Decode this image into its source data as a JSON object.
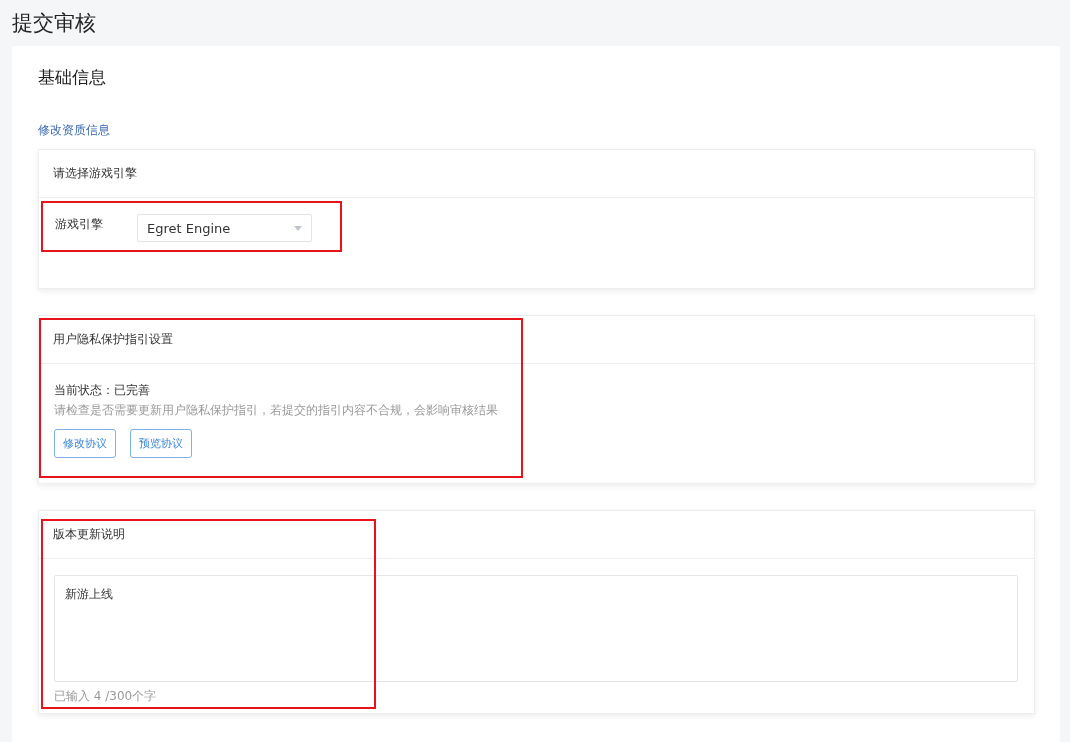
{
  "page_title": "提交审核",
  "section": {
    "title": "基础信息",
    "link": "修改资质信息"
  },
  "engine_card": {
    "title": "请选择游戏引擎",
    "highlighted": true,
    "field_label": "游戏引擎",
    "select_value": "Egret Engine"
  },
  "privacy_card": {
    "title": "用户隐私保护指引设置",
    "highlighted": true,
    "status": "当前状态：已完善",
    "hint": "请检查是否需要更新用户隐私保护指引，若提交的指引内容不合规，会影响审核结果",
    "buttons": [
      "修改协议",
      "预览协议"
    ]
  },
  "notes_card": {
    "title": "版本更新说明",
    "highlighted": true,
    "value": "新游上线",
    "counter": "已输入 4 /300个字"
  }
}
